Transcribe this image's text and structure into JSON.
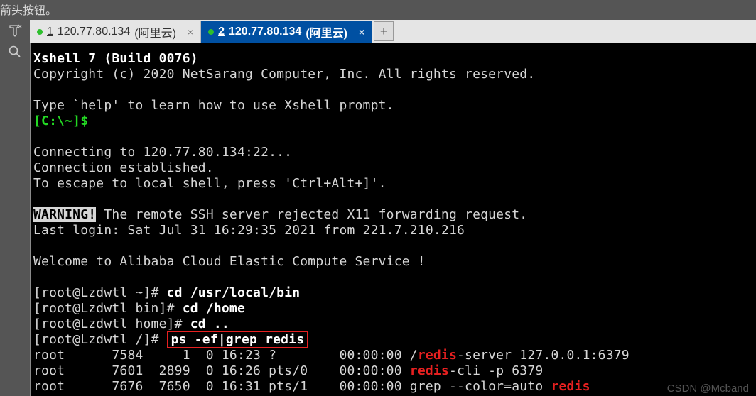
{
  "topbar": {
    "text": "箭头按钮。"
  },
  "sidebar": {
    "pin": "⇱",
    "search": "🔍"
  },
  "tabs": [
    {
      "index": "1",
      "ip": "120.77.80.134",
      "suffix": "(阿里云)",
      "close": "×",
      "active": false
    },
    {
      "index": "2",
      "ip": "120.77.80.134",
      "suffix": "(阿里云)",
      "close": "×",
      "active": true
    }
  ],
  "newtab": "+",
  "terminal": {
    "lines": {
      "l1": "Xshell 7 (Build 0076)",
      "l2": "Copyright (c) 2020 NetSarang Computer, Inc. All rights reserved.",
      "l3": "",
      "l4": "Type `help' to learn how to use Xshell prompt.",
      "l5a": "[C:\\~]$",
      "l6": "",
      "l7": "Connecting to 120.77.80.134:22...",
      "l8": "Connection established.",
      "l9": "To escape to local shell, press 'Ctrl+Alt+]'.",
      "l10": "",
      "l11a": "WARNING!",
      "l11b": " The remote SSH server rejected X11 forwarding request.",
      "l12": "Last login: Sat Jul 31 16:29:35 2021 from 221.7.210.216",
      "l13": "",
      "l14": "Welcome to Alibaba Cloud Elastic Compute Service !",
      "l15": "",
      "l16a": "[root@Lzdwtl ~]# ",
      "l16b": "cd /usr/local/bin",
      "l17a": "[root@Lzdwtl bin]# ",
      "l17b": "cd /home",
      "l18a": "[root@Lzdwtl home]# ",
      "l18b": "cd ..",
      "l19a": "[root@Lzdwtl /]# ",
      "l19b": "ps -ef|grep redis",
      "l20a": "root      7584     1  0 16:23 ?        00:00:00 /",
      "l20r": "redis",
      "l20b": "-server 127.0.0.1:6379",
      "l21a": "root      7601  2899  0 16:26 pts/0    00:00:00 ",
      "l21r": "redis",
      "l21b": "-cli -p 6379",
      "l22a": "root      7676  7650  0 16:31 pts/1    00:00:00 grep --color=auto ",
      "l22r": "redis"
    }
  },
  "watermark": "CSDN @Mcband"
}
